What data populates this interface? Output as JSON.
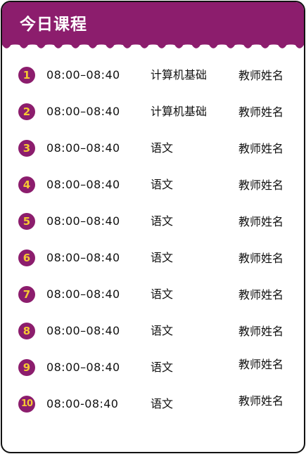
{
  "header": {
    "title": "今日课程",
    "color": "#8c1d6d"
  },
  "accent": {
    "badge_bg": "#8c1d6d",
    "badge_text": "#f5c833"
  },
  "schedule": [
    {
      "index": "1",
      "time": "08:00–08:40",
      "subject": "计算机基础",
      "teacher": "教师姓名"
    },
    {
      "index": "2",
      "time": "08:00–08:40",
      "subject": "计算机基础",
      "teacher": "教师姓名"
    },
    {
      "index": "3",
      "time": "08:00–08:40",
      "subject": "语文",
      "teacher": "教师姓名"
    },
    {
      "index": "4",
      "time": "08:00–08:40",
      "subject": "语文",
      "teacher": "教师姓名"
    },
    {
      "index": "5",
      "time": "08:00–08:40",
      "subject": "语文",
      "teacher": "教师姓名"
    },
    {
      "index": "6",
      "time": "08:00–08:40",
      "subject": "语文",
      "teacher": "教师姓名"
    },
    {
      "index": "7",
      "time": "08:00–08:40",
      "subject": "语文",
      "teacher": "教师姓名"
    },
    {
      "index": "8",
      "time": "08:00–08:40",
      "subject": "语文",
      "teacher": "教师姓名"
    },
    {
      "index": "9",
      "time": "08:00–08:40",
      "subject": "语文",
      "teacher": "教师姓名"
    },
    {
      "index": "10",
      "time": "08:00-08:40",
      "subject": "语文",
      "teacher": "教师姓名"
    }
  ]
}
